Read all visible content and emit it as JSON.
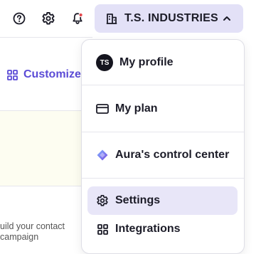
{
  "header": {
    "company_name": "T.S. INDUSTRIES",
    "icons": [
      "help-icon",
      "gear-icon",
      "bell-icon",
      "building-icon",
      "chevron-up-icon"
    ],
    "accent_color": "#e3e1f7",
    "notification_color": "#e5484d"
  },
  "background": {
    "customize_label": "Customize",
    "helper_text_line1": "uild your contact",
    "helper_text_line2": "campaign"
  },
  "menu": {
    "profile": {
      "initials": "TS",
      "label": "My profile"
    },
    "plan": {
      "label": "My plan"
    },
    "aura": {
      "label": "Aura's control center"
    },
    "settings": {
      "label": "Settings"
    },
    "integrations": {
      "label": "Integrations"
    },
    "highlight_color": "#e8e6f8"
  }
}
